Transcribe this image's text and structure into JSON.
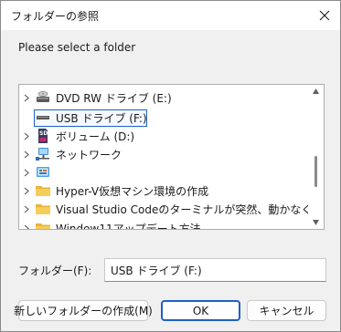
{
  "window": {
    "title": "フォルダーの参照",
    "close_label": "×"
  },
  "prompt": "Please select a folder",
  "tree": {
    "items": [
      {
        "label": "DVD RW ドライブ (E:)",
        "icon": "dvd-drive-icon",
        "expandable": true,
        "selected": false
      },
      {
        "label": "USB ドライブ (F:)",
        "icon": "usb-drive-icon",
        "expandable": false,
        "selected": true
      },
      {
        "label": "ボリューム (D:)",
        "icon": "sd-card-icon",
        "expandable": true,
        "selected": false
      },
      {
        "label": "ネットワーク",
        "icon": "network-icon",
        "expandable": true,
        "selected": false
      },
      {
        "label": "",
        "icon": "control-panel-icon",
        "expandable": true,
        "selected": false
      },
      {
        "label": "Hyper-V仮想マシン環境の作成",
        "icon": "folder-icon",
        "expandable": true,
        "selected": false
      },
      {
        "label": "Visual Studio Codeのターミナルが突然、動かなくなった時の",
        "icon": "folder-icon",
        "expandable": true,
        "selected": false
      },
      {
        "label": "Window11アップデート方法",
        "icon": "folder-icon",
        "expandable": true,
        "selected": false
      }
    ]
  },
  "folder_field": {
    "label": "フォルダー(F):",
    "value": "USB ドライブ (F:)"
  },
  "buttons": {
    "new_folder": "新しいフォルダーの作成(M)",
    "ok": "OK",
    "cancel": "キャンセル"
  },
  "colors": {
    "accent": "#1e60c8",
    "folder": "#f0c24a",
    "background": "#f0f0f0"
  }
}
